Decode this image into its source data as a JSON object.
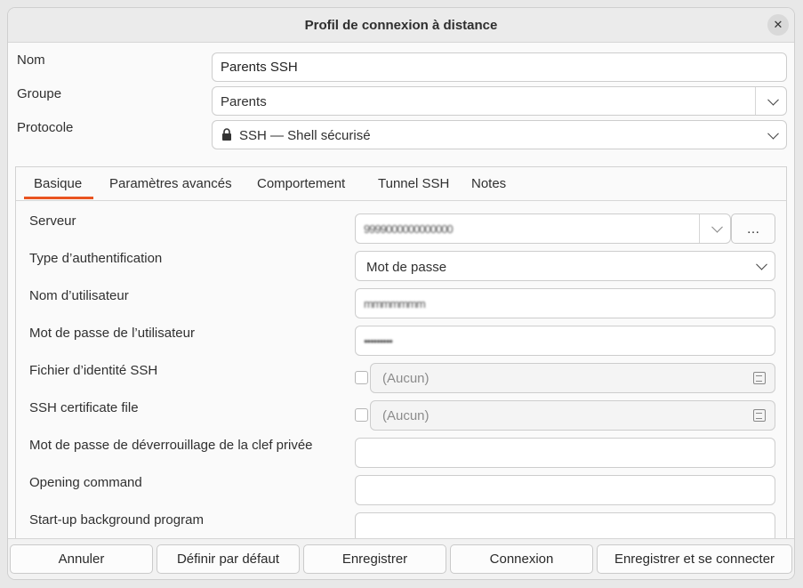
{
  "window": {
    "title": "Profil de connexion à distance",
    "close_glyph": "✕"
  },
  "form": {
    "name": {
      "label": "Nom",
      "value": "Parents SSH"
    },
    "group": {
      "label": "Groupe",
      "value": "Parents"
    },
    "protocol": {
      "label": "Protocole",
      "value": "SSH — Shell sécurisé",
      "icon": "lock-icon"
    }
  },
  "tabs": [
    "Basique",
    "Paramètres avancés",
    "Comportement",
    "Tunnel SSH",
    "Notes"
  ],
  "active_tab": "Basique",
  "basic": {
    "server": {
      "label": "Serveur",
      "value": "9999000000000000",
      "more": "…"
    },
    "auth_type": {
      "label": "Type d’authentification",
      "value": "Mot de passe"
    },
    "username": {
      "label": "Nom d’utilisateur",
      "value": "mmmmmmm"
    },
    "password": {
      "label": "Mot de passe de l’utilisateur",
      "value": "•••••••••"
    },
    "identity_file": {
      "label": "Fichier d’identité SSH",
      "value": "(Aucun)"
    },
    "certificate_file": {
      "label": "SSH certificate file",
      "value": "(Aucun)"
    },
    "unlock_password": {
      "label": "Mot de passe de déverrouillage de la clef privée",
      "value": ""
    },
    "opening_command": {
      "label": "Opening command",
      "value": ""
    },
    "startup_program": {
      "label": "Start-up background program",
      "value": ""
    }
  },
  "buttons": {
    "cancel": "Annuler",
    "set_default": "Définir par défaut",
    "save": "Enregistrer",
    "connect": "Connexion",
    "save_connect": "Enregistrer et se connecter"
  },
  "colors": {
    "accent": "#e95420"
  }
}
